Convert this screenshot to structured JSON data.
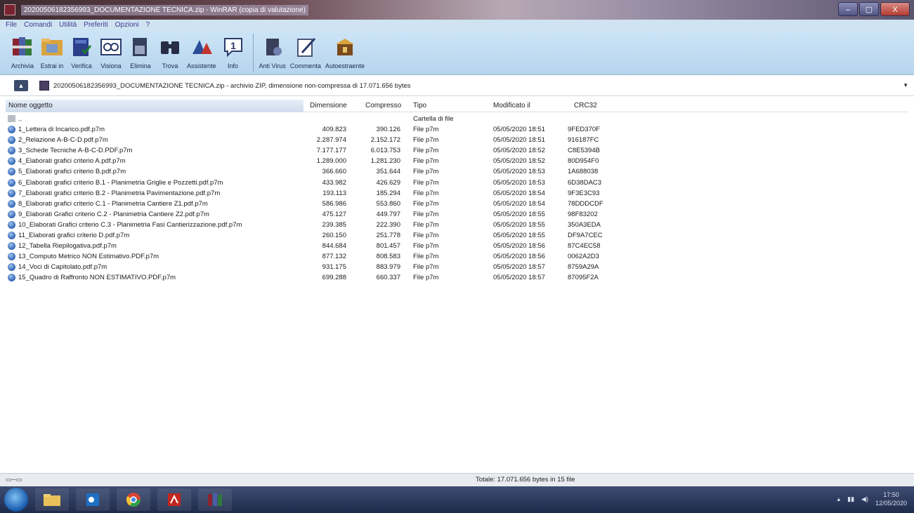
{
  "window": {
    "title": "20200506182356993_DOCUMENTAZIONE TECNICA.zip - WinRAR (copia di valutazione)",
    "controls": [
      "–",
      "▢",
      "X"
    ]
  },
  "menu": [
    "File",
    "Comandi",
    "Utilità",
    "Preferiti",
    "Opzioni",
    "?"
  ],
  "toolbar": [
    {
      "label": "Archivia",
      "icon": "archive-books-icon"
    },
    {
      "label": "Estrai in",
      "icon": "extract-folder-icon"
    },
    {
      "label": "Verifica",
      "icon": "test-book-icon"
    },
    {
      "label": "Visiona",
      "icon": "view-glasses-icon"
    },
    {
      "label": "Elimina",
      "icon": "delete-book-icon"
    },
    {
      "label": "Trova",
      "icon": "binoculars-icon"
    },
    {
      "label": "Assistente",
      "icon": "wizard-icon"
    },
    {
      "label": "Info",
      "icon": "info-icon"
    },
    {
      "label": "Anti Virus",
      "icon": "antivirus-icon"
    },
    {
      "label": "Commenta",
      "icon": "comment-pen-icon"
    },
    {
      "label": "Autoestraente",
      "icon": "sfx-box-icon"
    }
  ],
  "pathbar": {
    "text": "20200506182356993_DOCUMENTAZIONE TECNICA.zip - archivio ZIP, dimensione non-compressa di 17.071.656 bytes"
  },
  "columns": {
    "name": "Nome oggetto",
    "size": "Dimensione",
    "packed": "Compresso",
    "type": "Tipo",
    "modified": "Modificato il",
    "crc": "CRC32"
  },
  "parent_row": {
    "name": "..",
    "type": "Cartella di file"
  },
  "files": [
    {
      "name": "1_Lettera di Incarico.pdf.p7m",
      "size": "409.823",
      "packed": "390.126",
      "type": "File p7m",
      "modified": "05/05/2020 18:51",
      "crc": "9FED370F"
    },
    {
      "name": "2_Relazione A-B-C-D.pdf.p7m",
      "size": "2.287.974",
      "packed": "2.152.172",
      "type": "File p7m",
      "modified": "05/05/2020 18:51",
      "crc": "916187FC"
    },
    {
      "name": "3_Schede Tecniche A-B-C-D.PDF.p7m",
      "size": "7.177.177",
      "packed": "6.013.753",
      "type": "File p7m",
      "modified": "05/05/2020 18:52",
      "crc": "C8E5394B"
    },
    {
      "name": "4_Elaborati grafici criterio A.pdf.p7m",
      "size": "1.289.000",
      "packed": "1.281.230",
      "type": "File p7m",
      "modified": "05/05/2020 18:52",
      "crc": "80D954F0"
    },
    {
      "name": "5_Elaborati grafici criterio B.pdf.p7m",
      "size": "366.660",
      "packed": "351.644",
      "type": "File p7m",
      "modified": "05/05/2020 18:53",
      "crc": "1A688038"
    },
    {
      "name": "6_Elaborati grafici criterio B.1 - Planimetria Griglie e Pozzetti.pdf.p7m",
      "size": "433.982",
      "packed": "426.629",
      "type": "File p7m",
      "modified": "05/05/2020 18:53",
      "crc": "6D38DAC3"
    },
    {
      "name": "7_Elaborati grafici criterio B.2 - Planimetria Pavimentazione.pdf.p7m",
      "size": "193.113",
      "packed": "185.294",
      "type": "File p7m",
      "modified": "05/05/2020 18:54",
      "crc": "9F3E3C93"
    },
    {
      "name": "8_Elaborati grafici criterio C.1 - Planimetria Cantiere Z1.pdf.p7m",
      "size": "586.986",
      "packed": "553.860",
      "type": "File p7m",
      "modified": "05/05/2020 18:54",
      "crc": "78DDDCDF"
    },
    {
      "name": "9_Elaborati Grafici criterio C.2 - Planimetria Cantiere Z2.pdf.p7m",
      "size": "475.127",
      "packed": "449.797",
      "type": "File p7m",
      "modified": "05/05/2020 18:55",
      "crc": "98F83202"
    },
    {
      "name": "10_Elaborati Grafici criterio C.3 - Planimetria Fasi Cantierizzazione.pdf.p7m",
      "size": "239.385",
      "packed": "222.390",
      "type": "File p7m",
      "modified": "05/05/2020 18:55",
      "crc": "350A3EDA"
    },
    {
      "name": "11_Elaborati grafici criterio D.pdf.p7m",
      "size": "260.150",
      "packed": "251.778",
      "type": "File p7m",
      "modified": "05/05/2020 18:55",
      "crc": "DF9A7CEC"
    },
    {
      "name": "12_Tabella Riepilogativa.pdf.p7m",
      "size": "844.684",
      "packed": "801.457",
      "type": "File p7m",
      "modified": "05/05/2020 18:56",
      "crc": "87C4EC58"
    },
    {
      "name": "13_Computo Metrico NON Estimativo.PDF.p7m",
      "size": "877.132",
      "packed": "808.583",
      "type": "File p7m",
      "modified": "05/05/2020 18:56",
      "crc": "0062A2D3"
    },
    {
      "name": "14_Voci di Capitolato.pdf.p7m",
      "size": "931.175",
      "packed": "883.979",
      "type": "File p7m",
      "modified": "05/05/2020 18:57",
      "crc": "8759A29A"
    },
    {
      "name": "15_Quadro di Raffronto NON ESTIMATIVO.PDF.p7m",
      "size": "699.288",
      "packed": "660.337",
      "type": "File p7m",
      "modified": "05/05/2020 18:57",
      "crc": "87095F2A"
    }
  ],
  "status": {
    "total": "Totale: 17.071.656 bytes in 15 file"
  },
  "taskbar": {
    "apps": [
      "explorer-icon",
      "outlook-icon",
      "chrome-icon",
      "acrobat-icon",
      "winrar-icon"
    ],
    "clock_time": "17:50",
    "clock_date": "12/05/2020"
  }
}
